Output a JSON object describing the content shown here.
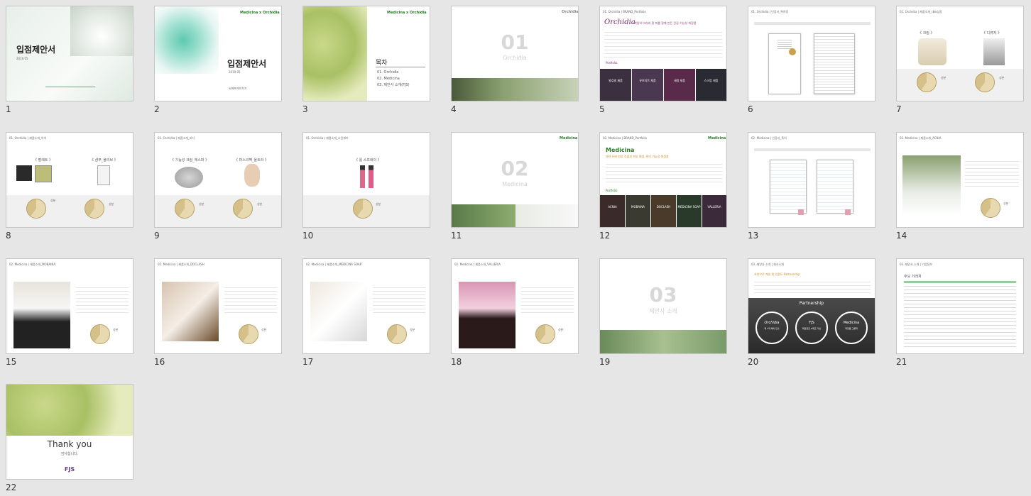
{
  "slides": [
    {
      "num": "1",
      "title": "입점제안서",
      "date": "2019.05"
    },
    {
      "num": "2",
      "logo": "Medicina x Orchidia",
      "title": "입점제안서",
      "date": "2019.05",
      "company": "씨에프에이치즈"
    },
    {
      "num": "3",
      "logo": "Medicina x Orchidia",
      "title": "목차",
      "toc": [
        "01. Orchidia",
        "02. Medicina",
        "03. 제안사 소개(FJS)"
      ]
    },
    {
      "num": "4",
      "logo": "Orchidia",
      "big": "01",
      "sub": "Orchidia"
    },
    {
      "num": "5",
      "header": "01. Orchidia | BRAND_Portfolio",
      "brand": "Orchidia",
      "tagline": "백일의 아라와 함 피를 함께 만든 민감 기능성 화장품",
      "portfolio": "Portfolio",
      "tiles": [
        "발효밀 제품",
        "유보지트 제품",
        "세럼 제품",
        "스크럽 제품"
      ]
    },
    {
      "num": "6",
      "header": "01. Orchidia | 인증서_특허증"
    },
    {
      "num": "7",
      "header": "01. Orchidia | 제품소개_대표상품",
      "labels": [
        "《 크림 》",
        "《 디퓨저 》"
      ],
      "legend": "성분"
    },
    {
      "num": "8",
      "header": "01. Orchidia | 제품소개_아이",
      "labels": [
        "《 팔레트 》",
        "《 샴푸_올리브 》"
      ],
      "legend": "성분"
    },
    {
      "num": "9",
      "header": "01. Orchidia | 제품소개_바디",
      "labels": [
        "《 기능성 크림_에스파 》",
        "《 마스크팩_울트라 》"
      ],
      "legend": "성분"
    },
    {
      "num": "10",
      "header": "01. Orchidia | 제품소개_스킨케어",
      "labels": [
        "《 롤 스프레이 》"
      ],
      "legend": "성분"
    },
    {
      "num": "11",
      "logo": "Medicina",
      "big": "02",
      "sub": "Medicina"
    },
    {
      "num": "12",
      "header": "02. Medicina | BRAND_Portfolio",
      "brand": "Medicina",
      "tagline": "자연 유래 원료 추출과 피부 재생, 관리 기능성 화장품",
      "portfolio": "Portfolio",
      "tiles": [
        "ACNIA",
        "MOBAINA",
        "DOCLASH",
        "MEDICINA SOAP",
        "VALLERIA"
      ]
    },
    {
      "num": "13",
      "header": "02. Medicina | 인증서_특허"
    },
    {
      "num": "14",
      "header": "02. Medicina | 제품소개_ACNIA",
      "legend": "성분"
    },
    {
      "num": "15",
      "header": "02. Medicina | 제품소개_MOBAINA",
      "legend": "성분"
    },
    {
      "num": "16",
      "header": "02. Medicina | 제품소개_DOCLASH",
      "legend": "성분"
    },
    {
      "num": "17",
      "header": "02. Medicina | 제품소개_MEDICINA SOAP",
      "legend": "성분"
    },
    {
      "num": "18",
      "header": "02. Medicina | 제품소개_VALLERIA",
      "legend": "성분"
    },
    {
      "num": "19",
      "big": "03",
      "sub": "제안사 소개"
    },
    {
      "num": "20",
      "header": "03. 제안사 소개 | 회사소개",
      "quote": "자연으로 계승 및 인원도 Partnership",
      "partnership": "Partnership",
      "circles": [
        "Orchidia",
        "FJS",
        "Medicina"
      ],
      "circle_subs": [
        "제 3국 해외 진출",
        "독점공급 &제조 기반",
        "화장품 그룹화"
      ]
    },
    {
      "num": "21",
      "header": "03. 제안사 소개 | 기업정보",
      "table_title": "주요 거래처"
    },
    {
      "num": "22",
      "title": "Thank you",
      "subtitle": "감사합니다.",
      "mark": "FJS"
    }
  ]
}
